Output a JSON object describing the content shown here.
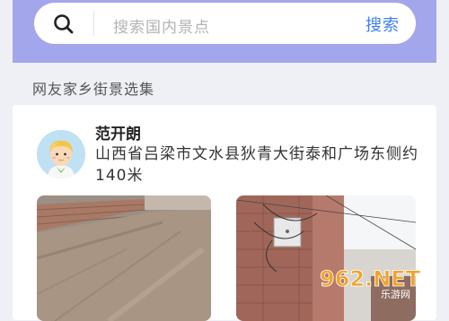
{
  "search": {
    "placeholder": "搜索国内景点",
    "button_label": "搜索",
    "icon": "search-icon"
  },
  "section": {
    "title": "网友家乡街景选集"
  },
  "post": {
    "user_name": "范开朗",
    "location": "山西省吕梁市文水县狄青大街泰和广场东侧约140米",
    "avatar": "avatar-cartoon-boy"
  },
  "watermark": {
    "text": "962.NET",
    "subtext": "乐游网"
  },
  "colors": {
    "header": "#a3a6ea",
    "accent": "#3f7ff0",
    "background": "#eef0f6"
  }
}
